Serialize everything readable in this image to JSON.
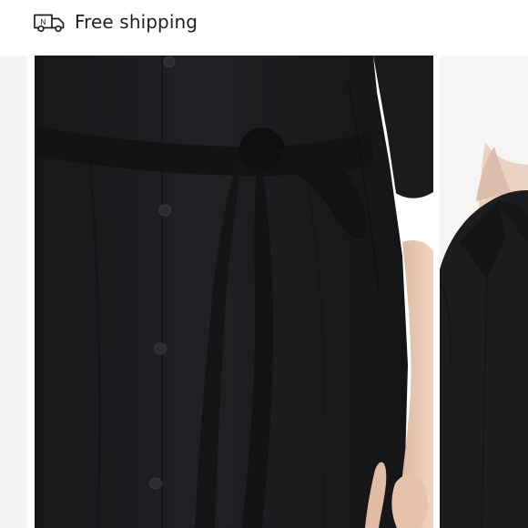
{
  "shipping": {
    "icon": "delivery-truck-icon",
    "icon_badge": "N",
    "label": "Free shipping"
  },
  "gallery": {
    "images": [
      {
        "name": "black-belted-shirt-dress-front"
      },
      {
        "name": "black-shirt-dress-collar"
      }
    ]
  },
  "colors": {
    "garment": "#1c1d1f",
    "skin": "#e8c8b4",
    "background": "#ffffff",
    "edge": "#f4f4f4"
  }
}
